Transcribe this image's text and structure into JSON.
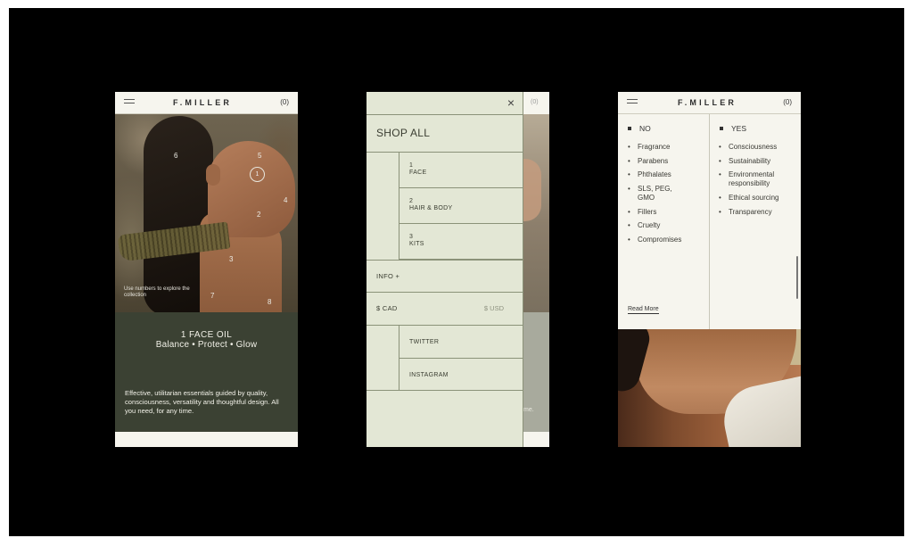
{
  "brand": "F.MILLER",
  "cart_label": "(0)",
  "screen1": {
    "hotspots": [
      "6",
      "5",
      "1",
      "4",
      "2",
      "3",
      "7",
      "8"
    ],
    "hint_text": "Use numbers to explore the collection",
    "product_title": "1   FACE OIL",
    "product_tagline": "Balance • Protect • Glow",
    "description": "Effective, utilitarian essentials guided by quality, consciousness, versatility and thoughtful design. All you need, for any time."
  },
  "screen2": {
    "close_icon": "×",
    "shop_all": "SHOP ALL",
    "categories": [
      {
        "num": "1",
        "label": "FACE"
      },
      {
        "num": "2",
        "label": "HAIR & BODY"
      },
      {
        "num": "3",
        "label": "KITS"
      }
    ],
    "info": "INFO  +",
    "currency_cad": "$ CAD",
    "currency_usd": "$ USD",
    "social": [
      "TWITTER",
      "INSTAGRAM"
    ],
    "behind_text": "me."
  },
  "screen3": {
    "no_heading": "NO",
    "yes_heading": "YES",
    "no_items": [
      "Fragrance",
      "Parabens",
      "Phthalates",
      "SLS, PEG, GMO",
      "Fillers",
      "Cruelty",
      "Compromises"
    ],
    "yes_items": [
      "Consciousness",
      "Sustainability",
      "Environmental responsibility",
      "Ethical sourcing",
      "Transparency"
    ],
    "read_more": "Read More"
  }
}
